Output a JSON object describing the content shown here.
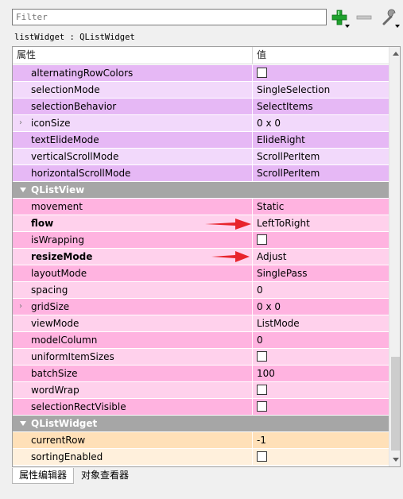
{
  "toolbar": {
    "filter_placeholder": "Filter",
    "add_icon": "plus-icon",
    "remove_icon": "minus-icon",
    "config_icon": "wrench-icon",
    "accent_green": "#1fa22e"
  },
  "object_label": "listWidget : QListWidget",
  "header": {
    "property": "属性",
    "value": "值"
  },
  "rows": [
    {
      "name": "alternatingRowColors",
      "value": "",
      "checkbox": true,
      "style": "purple-a"
    },
    {
      "name": "selectionMode",
      "value": "SingleSelection",
      "style": "purple-b"
    },
    {
      "name": "selectionBehavior",
      "value": "SelectItems",
      "style": "purple-a"
    },
    {
      "name": "iconSize",
      "value": "0 x 0",
      "expandable": true,
      "style": "purple-b"
    },
    {
      "name": "textElideMode",
      "value": "ElideRight",
      "style": "purple-a"
    },
    {
      "name": "verticalScrollMode",
      "value": "ScrollPerItem",
      "style": "purple-b"
    },
    {
      "name": "horizontalScrollMode",
      "value": "ScrollPerItem",
      "style": "purple-a"
    },
    {
      "name": "QListView",
      "section": true
    },
    {
      "name": "movement",
      "value": "Static",
      "style": "pink-a"
    },
    {
      "name": "flow",
      "value": "LeftToRight",
      "bold": true,
      "style": "pink-b"
    },
    {
      "name": "isWrapping",
      "value": "",
      "checkbox": true,
      "style": "pink-a"
    },
    {
      "name": "resizeMode",
      "value": "Adjust",
      "bold": true,
      "style": "pink-b"
    },
    {
      "name": "layoutMode",
      "value": "SinglePass",
      "style": "pink-a"
    },
    {
      "name": "spacing",
      "value": "0",
      "style": "pink-b"
    },
    {
      "name": "gridSize",
      "value": "0 x 0",
      "expandable": true,
      "style": "pink-a"
    },
    {
      "name": "viewMode",
      "value": "ListMode",
      "style": "pink-b"
    },
    {
      "name": "modelColumn",
      "value": "0",
      "style": "pink-a"
    },
    {
      "name": "uniformItemSizes",
      "value": "",
      "checkbox": true,
      "style": "pink-b"
    },
    {
      "name": "batchSize",
      "value": "100",
      "style": "pink-a"
    },
    {
      "name": "wordWrap",
      "value": "",
      "checkbox": true,
      "style": "pink-b"
    },
    {
      "name": "selectionRectVisible",
      "value": "",
      "checkbox": true,
      "style": "pink-a"
    },
    {
      "name": "QListWidget",
      "section": true
    },
    {
      "name": "currentRow",
      "value": "-1",
      "style": "peach-a"
    },
    {
      "name": "sortingEnabled",
      "value": "",
      "checkbox": true,
      "style": "peach-b"
    }
  ],
  "tabs": [
    {
      "label": "属性编辑器",
      "active": true
    },
    {
      "label": "对象查看器",
      "active": false
    }
  ],
  "colors": {
    "section_bg": "#a6a6a6",
    "purple": "#e6b8f5",
    "pink": "#ffb3e0",
    "peach": "#ffe0b8",
    "annotation_arrow": "#e8242c"
  }
}
